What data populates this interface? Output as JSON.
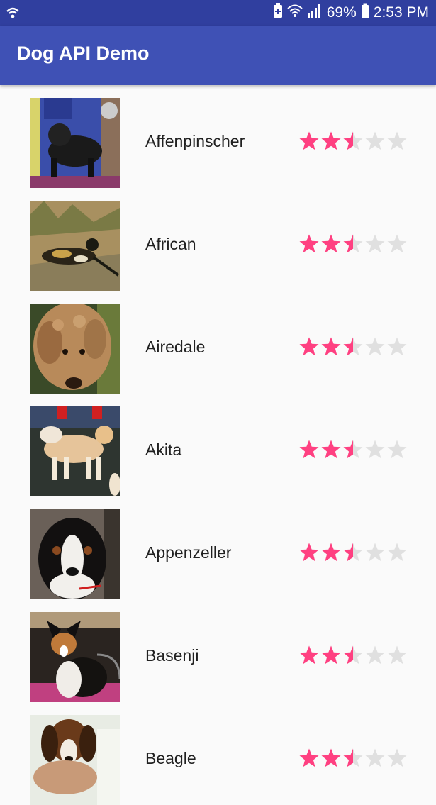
{
  "status_bar": {
    "battery_percent": "69%",
    "time": "2:53 PM",
    "icons": [
      "wifi-calling-icon",
      "battery-saver-icon",
      "wifi-icon",
      "signal-icon",
      "battery-icon"
    ]
  },
  "app_bar": {
    "title": "Dog API Demo"
  },
  "colors": {
    "status_bar": "#303f9f",
    "app_bar": "#3f51b5",
    "star_filled": "#ff4081",
    "star_empty": "#e0e0e0"
  },
  "breeds": [
    {
      "name": "Affenpinscher",
      "rating": 2.5,
      "max_rating": 5
    },
    {
      "name": "African",
      "rating": 2.5,
      "max_rating": 5
    },
    {
      "name": "Airedale",
      "rating": 2.5,
      "max_rating": 5
    },
    {
      "name": "Akita",
      "rating": 2.5,
      "max_rating": 5
    },
    {
      "name": "Appenzeller",
      "rating": 2.5,
      "max_rating": 5
    },
    {
      "name": "Basenji",
      "rating": 2.5,
      "max_rating": 5
    },
    {
      "name": "Beagle",
      "rating": 2.5,
      "max_rating": 5
    }
  ]
}
